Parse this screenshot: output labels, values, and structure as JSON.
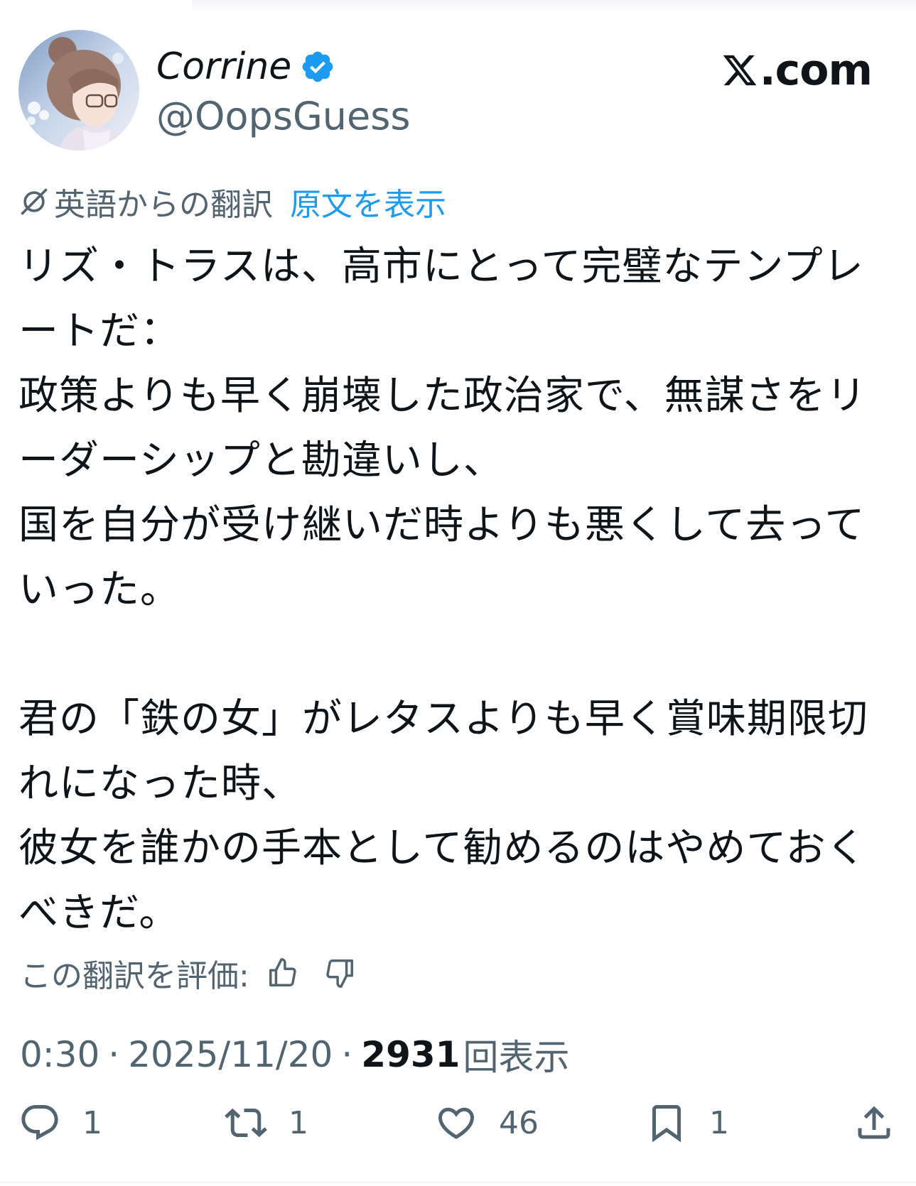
{
  "author": {
    "display_name": "Corrine",
    "handle": "@OopsGuess",
    "verified": true
  },
  "brand": {
    "text": ".com",
    "icon": "x-logo-icon"
  },
  "translation": {
    "label": "英語からの翻訳",
    "show_original": "原文を表示"
  },
  "tweet": {
    "text": "リズ・トラスは、高市にとって完璧なテンプレートだ：\n政策よりも早く崩壊した政治家で、無謀さをリーダーシップと勘違いし、\n国を自分が受け継いだ時よりも悪くして去っていった。\n\n君の「鉄の女」がレタスよりも早く賞味期限切れになった時、\n彼女を誰かの手本として勧めるのはやめておくべきだ。"
  },
  "rate": {
    "label": "この翻訳を評価:"
  },
  "meta": {
    "time": "0:30",
    "separator": "·",
    "date": "2025/11/20",
    "views": "2931",
    "views_label": "回表示"
  },
  "actions": {
    "replies": "1",
    "retweets": "1",
    "likes": "46",
    "bookmarks": "1"
  },
  "colors": {
    "accent": "#1d9bf0",
    "text_primary": "#0f1419",
    "text_secondary": "#536471"
  }
}
